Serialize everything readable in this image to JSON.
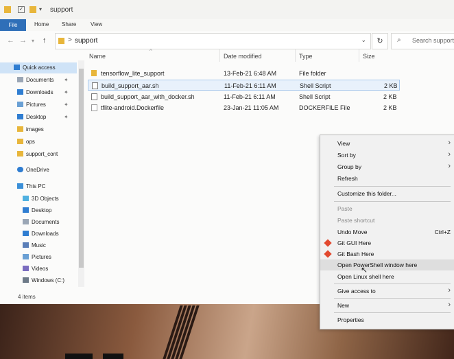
{
  "window": {
    "title": "support"
  },
  "ribbon": {
    "tabs": [
      "File",
      "Home",
      "Share",
      "View"
    ]
  },
  "address": {
    "path": "support",
    "separator": ">"
  },
  "search": {
    "placeholder": "Search support"
  },
  "nav": {
    "items": [
      {
        "label": "Quick access",
        "icon": "star-icon",
        "selected": true
      },
      {
        "label": "Documents",
        "icon": "documents-icon",
        "pinned": true
      },
      {
        "label": "Downloads",
        "icon": "download-icon",
        "pinned": true
      },
      {
        "label": "Pictures",
        "icon": "pictures-icon",
        "pinned": true
      },
      {
        "label": "Desktop",
        "icon": "desktop-icon",
        "pinned": true
      },
      {
        "label": "images",
        "icon": "folder-icon"
      },
      {
        "label": "ops",
        "icon": "folder-icon"
      },
      {
        "label": "support_cont",
        "icon": "folder-icon"
      },
      {
        "label": "OneDrive",
        "icon": "cloud-icon"
      },
      {
        "label": "This PC",
        "icon": "computer-icon"
      },
      {
        "label": "3D Objects",
        "icon": "cube-icon"
      },
      {
        "label": "Desktop",
        "icon": "desktop-icon"
      },
      {
        "label": "Documents",
        "icon": "documents-icon"
      },
      {
        "label": "Downloads",
        "icon": "download-icon"
      },
      {
        "label": "Music",
        "icon": "music-icon"
      },
      {
        "label": "Pictures",
        "icon": "pictures-icon"
      },
      {
        "label": "Videos",
        "icon": "videos-icon"
      },
      {
        "label": "Windows (C:)",
        "icon": "drive-icon"
      }
    ]
  },
  "columns": [
    "Name",
    "Date modified",
    "Type",
    "Size"
  ],
  "files": [
    {
      "name": "tensorflow_lite_support",
      "date": "13-Feb-21 6:48 AM",
      "type": "File folder",
      "size": "",
      "icon": "folder-icon"
    },
    {
      "name": "build_support_aar.sh",
      "date": "11-Feb-21 6:11 AM",
      "type": "Shell Script",
      "size": "2 KB",
      "icon": "script-icon"
    },
    {
      "name": "build_support_aar_with_docker.sh",
      "date": "11-Feb-21 6:11 AM",
      "type": "Shell Script",
      "size": "2 KB",
      "icon": "script-icon"
    },
    {
      "name": "tflite-android.Dockerfile",
      "date": "23-Jan-21 11:05 AM",
      "type": "DOCKERFILE File",
      "size": "2 KB",
      "icon": "file-icon"
    }
  ],
  "status": {
    "items": "4 items"
  },
  "context_menu": {
    "items": [
      {
        "label": "View"
      },
      {
        "label": "Sort by"
      },
      {
        "label": "Group by"
      },
      {
        "label": "Refresh"
      },
      {
        "label": "Customize this folder..."
      },
      {
        "label": "Paste"
      },
      {
        "label": "Paste shortcut"
      },
      {
        "label": "Undo Move",
        "shortcut": "Ctrl+Z"
      },
      {
        "label": "Git GUI Here"
      },
      {
        "label": "Git Bash Here"
      },
      {
        "label": "Open PowerShell window here"
      },
      {
        "label": "Open Linux shell here"
      },
      {
        "label": "Give access to"
      },
      {
        "label": "New"
      },
      {
        "label": "Properties"
      }
    ]
  },
  "colors": {
    "accent": "#2f6fb8",
    "folder": "#e8b63b",
    "git": "#e2492f",
    "selection": "#cfe3f7"
  }
}
